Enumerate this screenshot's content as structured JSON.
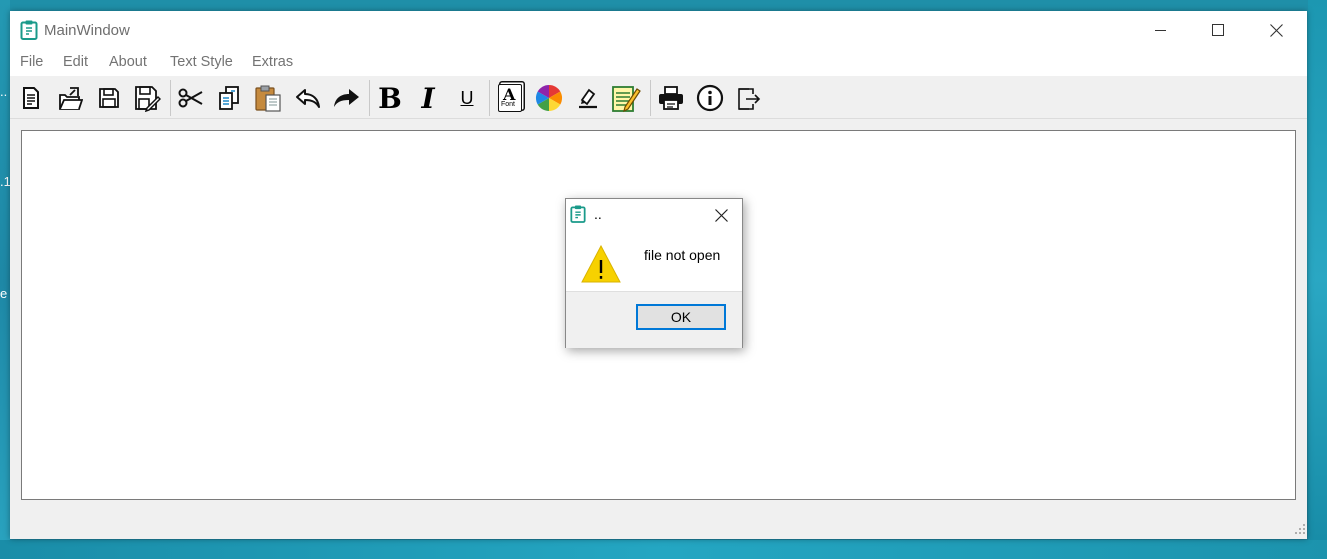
{
  "window": {
    "title": "MainWindow",
    "controls": [
      "minimize-icon",
      "maximize-icon",
      "close-icon"
    ]
  },
  "desktop": {
    "fragments": [
      "..",
      ".1",
      "e"
    ]
  },
  "menubar": {
    "items": [
      "File",
      "Edit",
      "About",
      "Text Style",
      "Extras"
    ]
  },
  "toolbar": {
    "groups": [
      [
        "new-file-icon",
        "open-file-icon",
        "save-icon",
        "save-as-icon"
      ],
      [
        "cut-icon",
        "copy-icon",
        "paste-icon",
        "undo-icon",
        "redo-icon"
      ],
      [
        "bold-icon",
        "italic-icon",
        "underline-icon"
      ],
      [
        "font-icon",
        "color-wheel-icon",
        "highlight-icon",
        "edit-notes-icon"
      ],
      [
        "print-icon",
        "info-icon",
        "exit-icon"
      ]
    ],
    "labels": {
      "bold": "B",
      "italic": "I",
      "underline": "U",
      "font": "A",
      "font_caption": "Font"
    }
  },
  "editor": {
    "value": ""
  },
  "dialog": {
    "title": "..",
    "message": "file not open",
    "ok_label": "OK",
    "icon": "warning-icon"
  },
  "colors": {
    "accent": "#0078d7",
    "warning_fill": "#f7d100",
    "app_icon": "#1a9a8a"
  }
}
